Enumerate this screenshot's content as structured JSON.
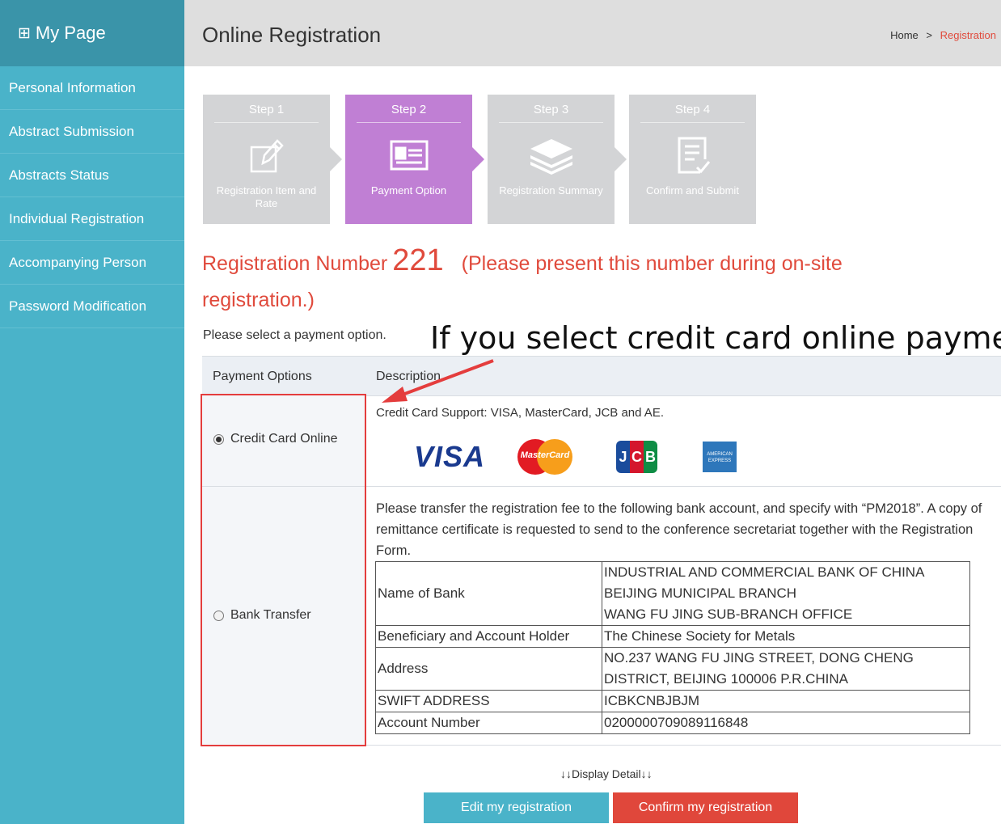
{
  "sidebar": {
    "title": "My Page",
    "title_icon": "grid-icon",
    "items": [
      {
        "label": "Personal Information"
      },
      {
        "label": "Abstract Submission"
      },
      {
        "label": "Abstracts Status"
      },
      {
        "label": "Individual Registration"
      },
      {
        "label": "Accompanying Person"
      },
      {
        "label": "Password Modification"
      }
    ]
  },
  "header": {
    "title": "Online Registration",
    "breadcrumb": {
      "home": "Home",
      "separator": ">",
      "current": "Registration"
    }
  },
  "steps": [
    {
      "num": "Step 1",
      "label": "Registration Item and Rate",
      "icon": "edit-form-icon",
      "active": false
    },
    {
      "num": "Step 2",
      "label": "Payment Option",
      "icon": "id-card-icon",
      "active": true
    },
    {
      "num": "Step 3",
      "label": "Registration Summary",
      "icon": "layers-icon",
      "active": false
    },
    {
      "num": "Step 4",
      "label": "Confirm and Submit",
      "icon": "checklist-icon",
      "active": false
    }
  ],
  "registration": {
    "prefix": "Registration Number",
    "number": "221",
    "note": "(Please present this number during on-site registration.)"
  },
  "select_prompt": "Please select a payment option.",
  "annotation_text": "If you select credit card online payme",
  "payment_table": {
    "header_options": "Payment Options",
    "header_description": "Description",
    "credit": {
      "label": "Credit Card Online",
      "selected": true,
      "support_text": "Credit Card Support: VISA, MasterCard, JCB and AE.",
      "logos": [
        "VISA",
        "MasterCard",
        "JCB",
        "AMERICAN EXPRESS"
      ]
    },
    "bank": {
      "label": "Bank Transfer",
      "selected": false,
      "instructions": "Please transfer the registration fee to the following bank account, and specify with “PM2018”. A copy of remittance certificate is requested to send to the conference secretariat together with the Registration Form.",
      "rows": [
        {
          "key": "Name of Bank",
          "value": "INDUSTRIAL AND COMMERCIAL BANK OF CHINA\nBEIJING MUNICIPAL BRANCH\nWANG FU JING SUB-BRANCH OFFICE"
        },
        {
          "key": "Beneficiary and Account Holder",
          "value": "The Chinese Society for Metals"
        },
        {
          "key": "Address",
          "value": "NO.237 WANG FU JING STREET, DONG CHENG DISTRICT, BEIJING 100006 P.R.CHINA"
        },
        {
          "key": "SWIFT ADDRESS",
          "value": "ICBKCNBJBJM"
        },
        {
          "key": "Account Number",
          "value": "0200000709089116848"
        }
      ]
    }
  },
  "display_detail": "↓↓Display Detail↓↓",
  "buttons": {
    "edit": "Edit my registration",
    "confirm": "Confirm my registration"
  },
  "colors": {
    "sidebar": "#4ab3c9",
    "sidebar_head": "#3a94a9",
    "active_step": "#c07fd4",
    "inactive_step": "#d3d4d6",
    "accent_red": "#e04a3c"
  }
}
